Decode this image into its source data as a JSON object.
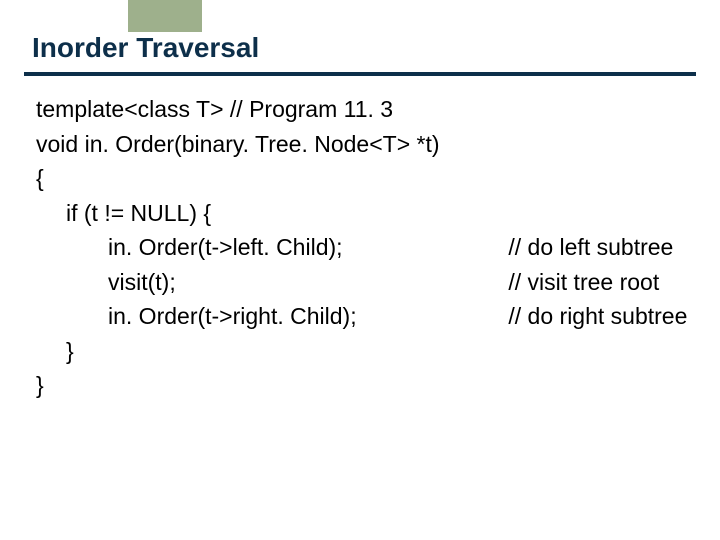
{
  "title": "Inorder Traversal",
  "code": {
    "l0": {
      "stmt": "template<class T> // Program 11. 3"
    },
    "l1": {
      "stmt": "void in. Order(binary. Tree. Node<T> *t)"
    },
    "l2": {
      "stmt": "{"
    },
    "l3": {
      "stmt": "if (t != NULL) {"
    },
    "l4": {
      "stmt": "in. Order(t->left. Child);",
      "cmt": "// do left subtree"
    },
    "l5": {
      "stmt": "visit(t);",
      "cmt": "// visit tree root"
    },
    "l6": {
      "stmt": "in. Order(t->right. Child);",
      "cmt": "// do right subtree"
    },
    "l7": {
      "stmt": "}"
    },
    "l8": {
      "stmt": "}"
    }
  },
  "colors": {
    "accent_block": "#9eb08c",
    "divider": "#0d2f4a",
    "title": "#0d2f4a",
    "body_text": "#000000"
  }
}
